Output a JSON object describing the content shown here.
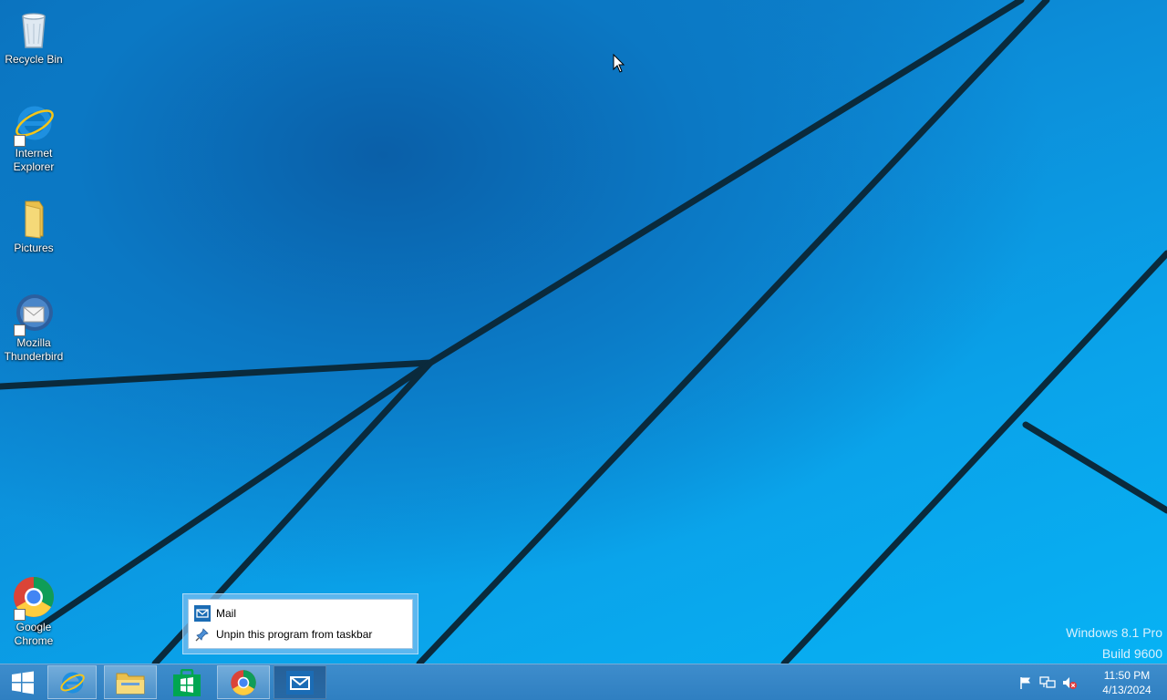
{
  "desktop": {
    "icons": [
      {
        "label": "Recycle Bin"
      },
      {
        "label": "Internet Explorer"
      },
      {
        "label": "Pictures"
      },
      {
        "label": "Mozilla Thunderbird"
      },
      {
        "label": "Google Chrome"
      }
    ],
    "watermark": {
      "line1": "Windows 8.1 Pro",
      "line2": "Build 9600"
    }
  },
  "jumplist": {
    "items": [
      {
        "label": "Mail",
        "icon": "mail-icon"
      },
      {
        "label": "Unpin this program from taskbar",
        "icon": "pin-icon"
      }
    ]
  },
  "taskbar": {
    "buttons": [
      {
        "name": "start",
        "icon": "windows-logo-icon"
      },
      {
        "name": "internet-explorer",
        "icon": "ie-icon"
      },
      {
        "name": "file-explorer",
        "icon": "folder-icon"
      },
      {
        "name": "store",
        "icon": "store-icon"
      },
      {
        "name": "chrome",
        "icon": "chrome-icon"
      },
      {
        "name": "mail",
        "icon": "mail-icon"
      }
    ],
    "tray": {
      "icons": [
        "action-center-flag-icon",
        "network-icon",
        "volume-muted-icon"
      ],
      "time": "11:50 PM",
      "date": "4/13/2024"
    }
  },
  "colors": {
    "accent": "#0aa0e6",
    "taskbar": "#3a88c8",
    "mail_blue": "#1b6cb5"
  }
}
